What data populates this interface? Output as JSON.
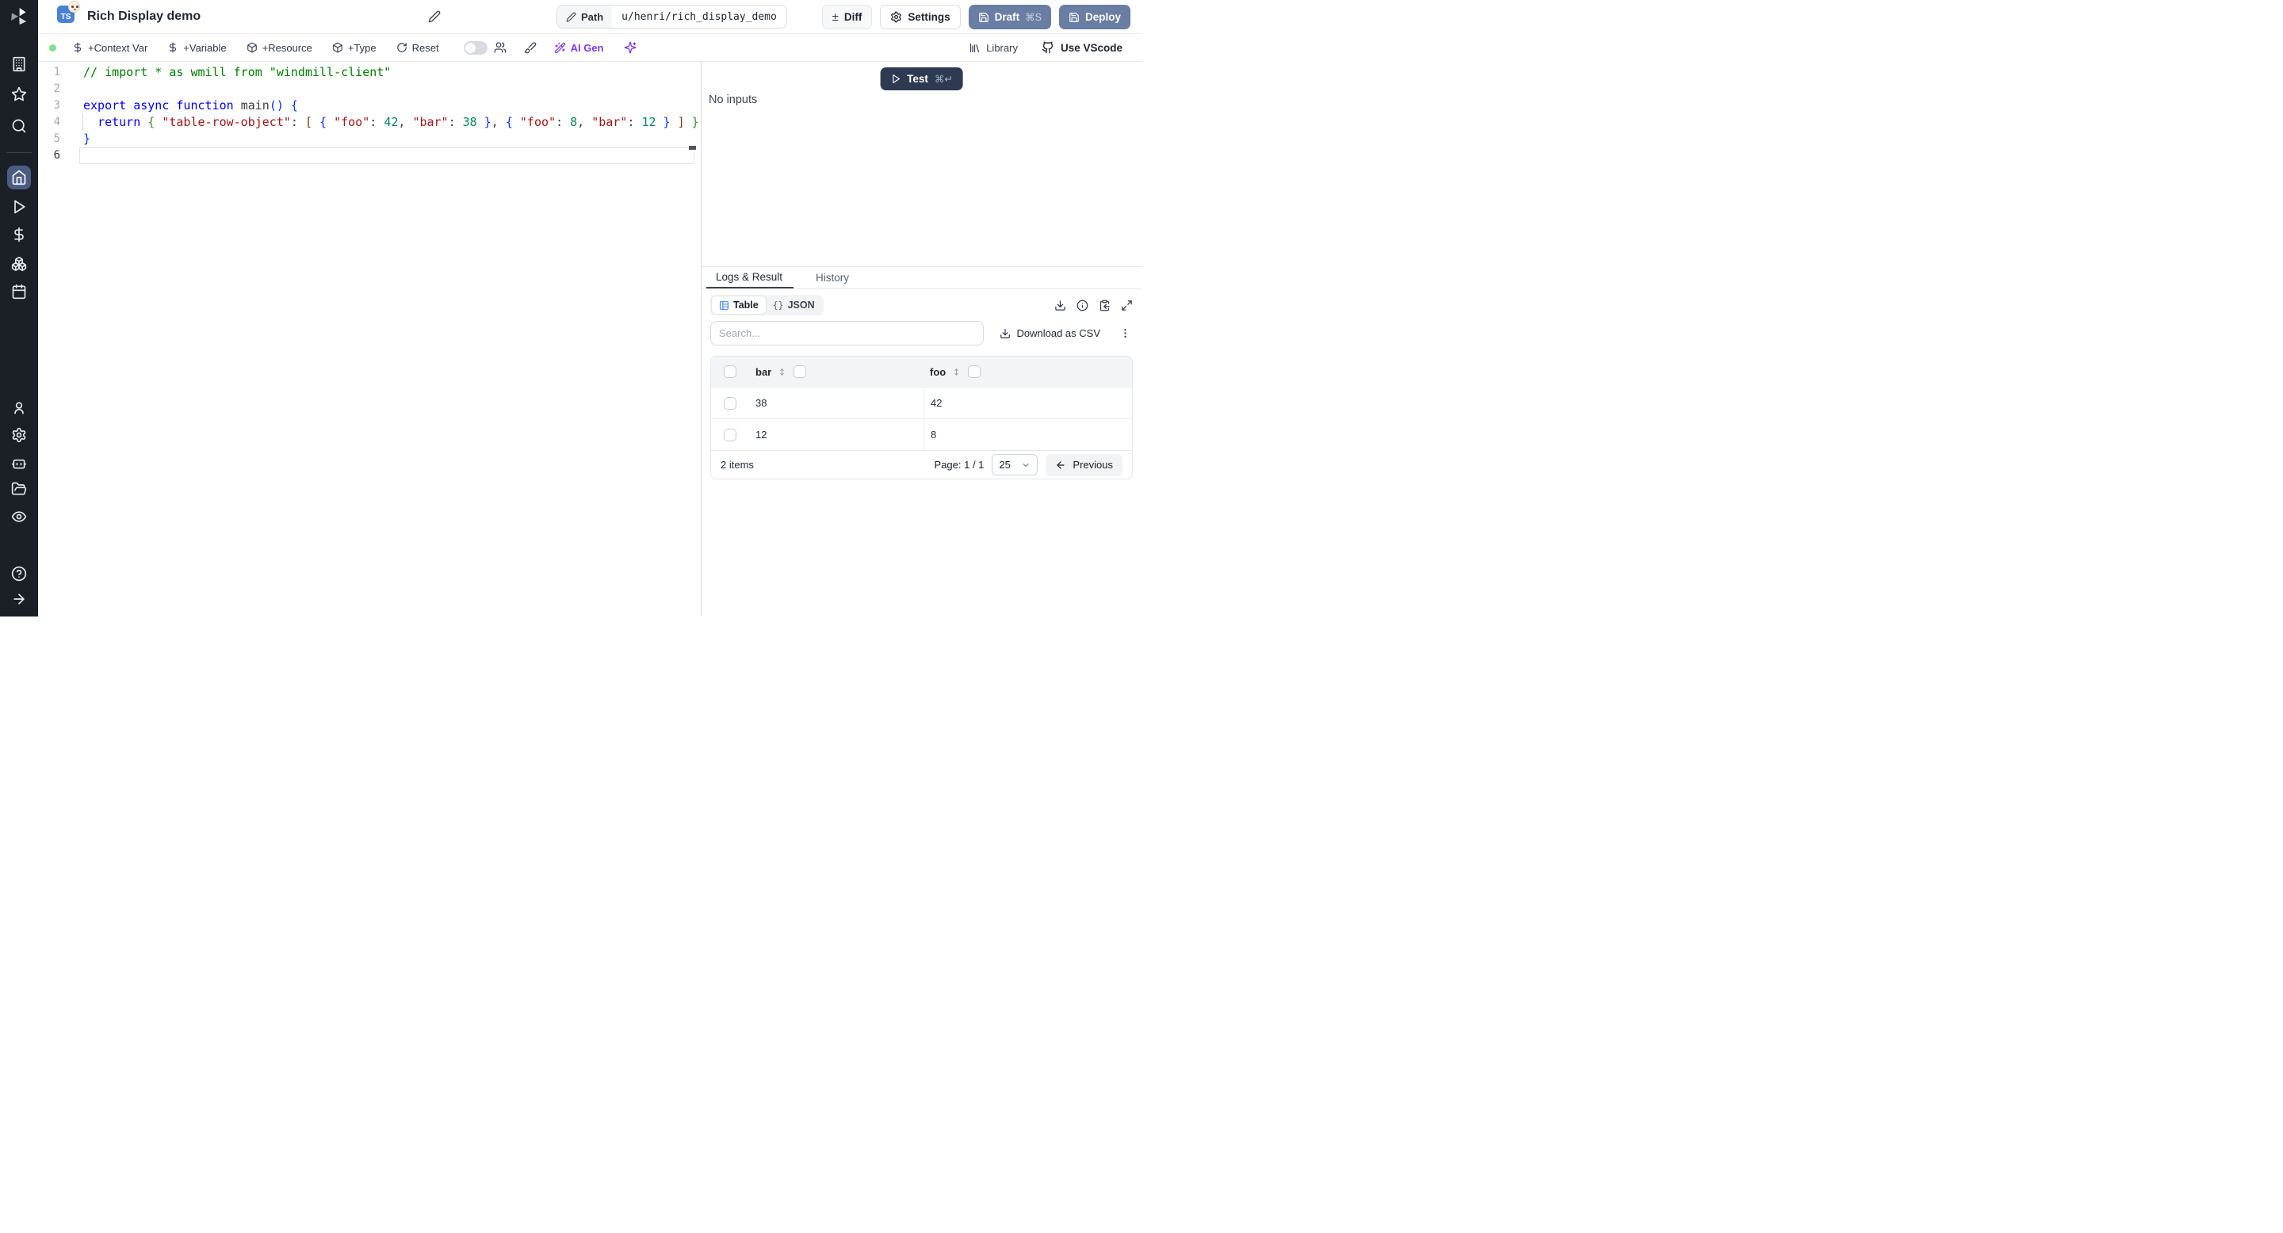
{
  "colors": {
    "accent_blue": "#3b82f6",
    "ai_purple": "#7c3aed",
    "slate_button": "#6a7da2",
    "dark_button": "#2e3a52",
    "status_green": "#7ee08c",
    "sidebar_bg": "#1b2027"
  },
  "sidebar": {
    "active_item": "home",
    "icons": [
      "windmill-logo",
      "workspace-building",
      "favorites-star",
      "search",
      "home",
      "runs-play",
      "variables-dollar",
      "resources-boxes",
      "schedules-calendar",
      "user",
      "settings-gear",
      "workers-robot",
      "folders",
      "audit-eye",
      "help",
      "expand-arrow"
    ]
  },
  "header": {
    "language_badge": "TS",
    "emoji": "baby-face",
    "title": "Rich Display demo",
    "path_label": "Path",
    "path_value": "u/henri/rich_display_demo",
    "diff_label": "Diff",
    "diff_glyph": "±",
    "settings_label": "Settings",
    "draft_label": "Draft",
    "draft_shortcut": "⌘S",
    "deploy_label": "Deploy"
  },
  "toolbar": {
    "context_var": "+Context Var",
    "variable": "+Variable",
    "resource": "+Resource",
    "type": "+Type",
    "reset": "Reset",
    "ai_gen": "AI Gen",
    "library": "Library",
    "use_vscode": "Use VScode"
  },
  "editor": {
    "lines": [
      {
        "num": "1",
        "tokens": [
          [
            "// import * as wmill from \"windmill-client\"",
            "c"
          ]
        ]
      },
      {
        "num": "2",
        "tokens": []
      },
      {
        "num": "3",
        "tokens": [
          [
            "export async function ",
            "k"
          ],
          [
            "main",
            "p"
          ],
          [
            "(",
            "b1"
          ],
          [
            ")",
            "b1"
          ],
          [
            " ",
            "p"
          ],
          [
            "{",
            "b1"
          ]
        ]
      },
      {
        "num": "4",
        "tokens": [
          [
            "  ",
            "p"
          ],
          [
            "return",
            "k"
          ],
          [
            " ",
            "p"
          ],
          [
            "{",
            "b2"
          ],
          [
            " ",
            "p"
          ],
          [
            "\"table-row-object\"",
            "s"
          ],
          [
            ":",
            "p"
          ],
          [
            " ",
            "p"
          ],
          [
            "[",
            "b3"
          ],
          [
            " ",
            "p"
          ],
          [
            "{",
            "b1"
          ],
          [
            " ",
            "p"
          ],
          [
            "\"foo\"",
            "s"
          ],
          [
            ":",
            "p"
          ],
          [
            " ",
            "p"
          ],
          [
            "42",
            "n"
          ],
          [
            ",",
            "p"
          ],
          [
            " ",
            "p"
          ],
          [
            "\"bar\"",
            "s"
          ],
          [
            ":",
            "p"
          ],
          [
            " ",
            "p"
          ],
          [
            "38",
            "n"
          ],
          [
            " ",
            "p"
          ],
          [
            "}",
            "b1"
          ],
          [
            ",",
            "p"
          ],
          [
            " ",
            "p"
          ],
          [
            "{",
            "b1"
          ],
          [
            " ",
            "p"
          ],
          [
            "\"foo\"",
            "s"
          ],
          [
            ":",
            "p"
          ],
          [
            " ",
            "p"
          ],
          [
            "8",
            "n"
          ],
          [
            ",",
            "p"
          ],
          [
            " ",
            "p"
          ],
          [
            "\"bar\"",
            "s"
          ],
          [
            ":",
            "p"
          ],
          [
            " ",
            "p"
          ],
          [
            "12",
            "n"
          ],
          [
            " ",
            "p"
          ],
          [
            "}",
            "b1"
          ],
          [
            " ",
            "p"
          ],
          [
            "]",
            "b3"
          ],
          [
            " ",
            "p"
          ],
          [
            "}",
            "b2"
          ]
        ]
      },
      {
        "num": "5",
        "tokens": [
          [
            "}",
            "b1"
          ]
        ]
      },
      {
        "num": "6",
        "tokens": [],
        "current": true
      }
    ]
  },
  "panel": {
    "test_label": "Test",
    "test_shortcut": "⌘↵",
    "no_inputs": "No inputs",
    "tabs": {
      "logs": "Logs & Result",
      "history": "History"
    },
    "view_toggle": {
      "table": "Table",
      "json": "JSON",
      "json_glyph": "{}"
    },
    "search_placeholder": "Search...",
    "download_csv": "Download as CSV",
    "table": {
      "columns": [
        "bar",
        "foo"
      ],
      "rows": [
        [
          "38",
          "42"
        ],
        [
          "12",
          "8"
        ]
      ],
      "items_text": "2 items",
      "page_text": "Page: 1 / 1",
      "page_size": "25",
      "previous": "Previous"
    }
  }
}
